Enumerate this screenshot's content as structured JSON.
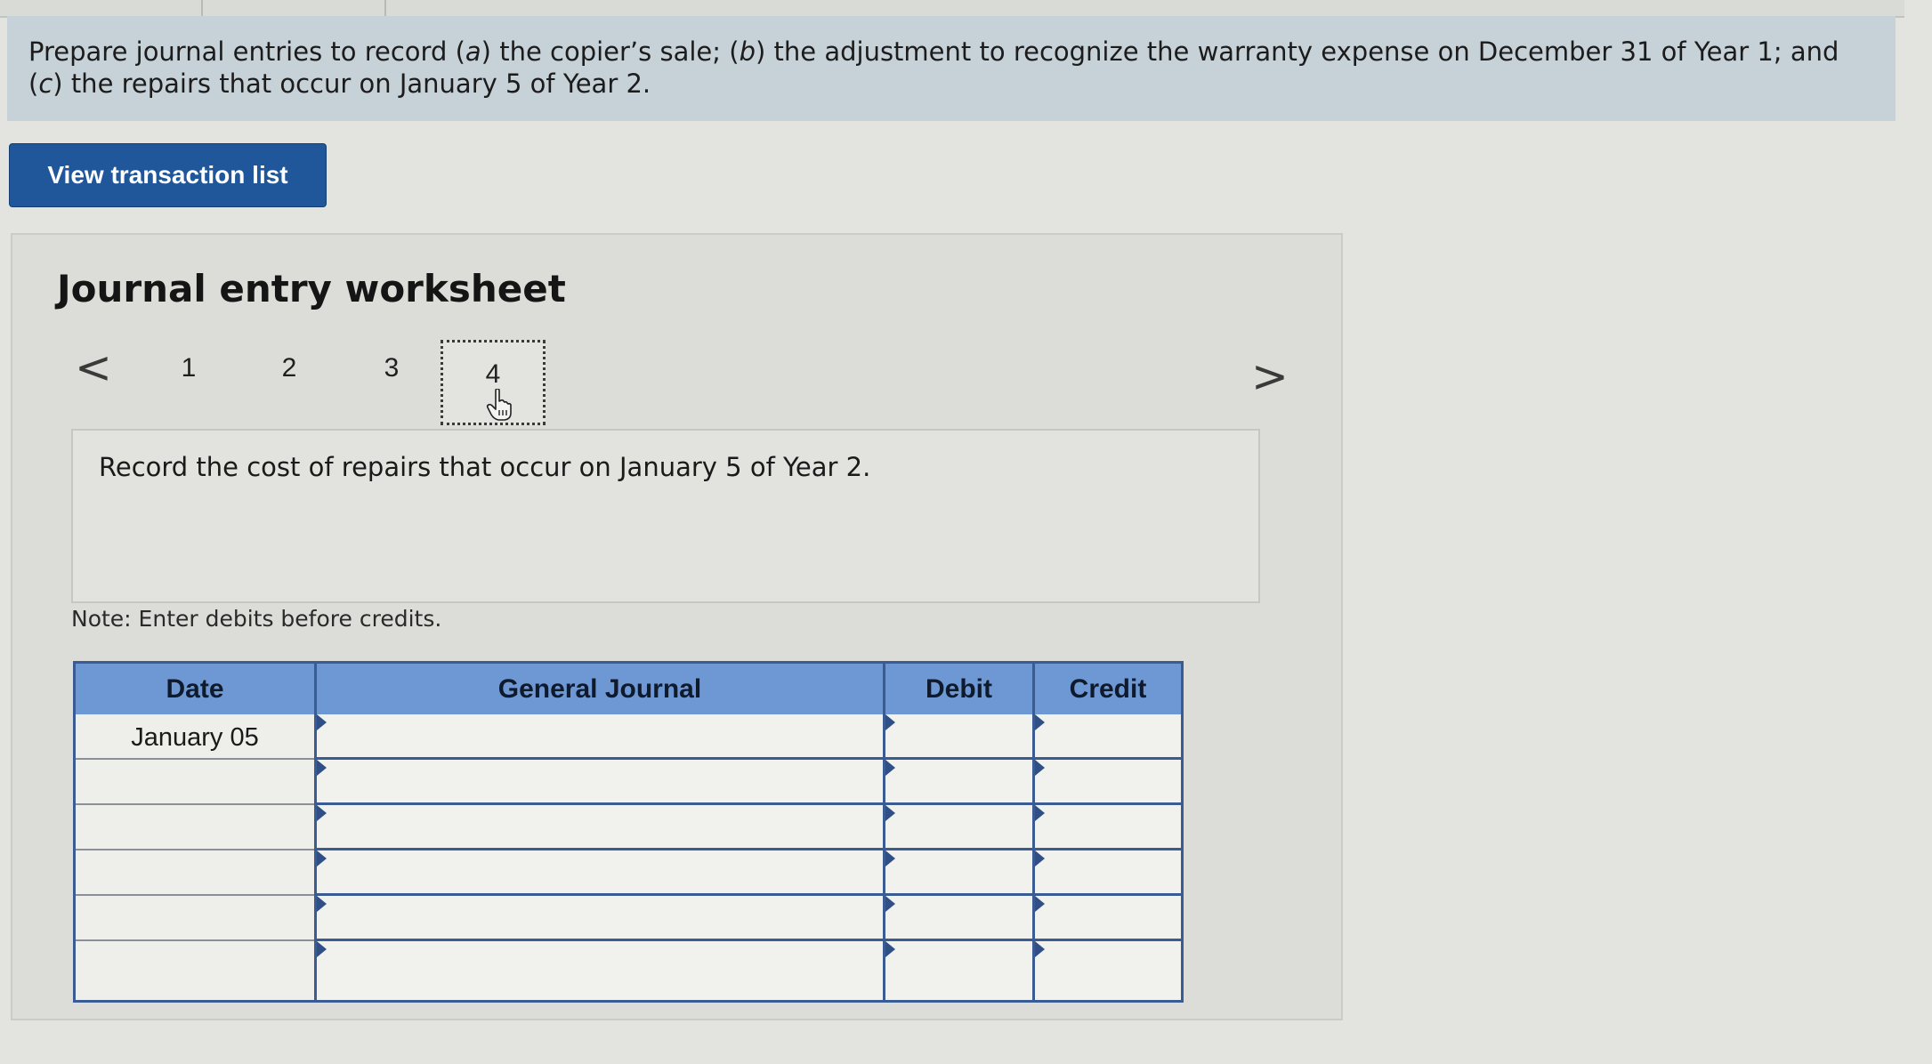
{
  "instructions": {
    "prefix": "Prepare journal entries to record (",
    "a": "a",
    "mid1": ") the copier’s sale; (",
    "b": "b",
    "mid2": ") the adjustment to recognize the warranty expense on December 31 of Year 1; and (",
    "c": "c",
    "suffix": ") the repairs that occur on January 5 of Year 2."
  },
  "view_transaction_button": "View transaction list",
  "worksheet": {
    "title": "Journal entry worksheet",
    "prev_arrow": "<",
    "next_arrow": ">",
    "pages": [
      "1",
      "2",
      "3",
      "4"
    ],
    "current_page": "4",
    "prompt": "Record the cost of repairs that occur on January 5 of Year 2.",
    "note": "Note: Enter debits before credits."
  },
  "journal": {
    "headers": {
      "date": "Date",
      "general_journal": "General Journal",
      "debit": "Debit",
      "credit": "Credit"
    },
    "rows": [
      {
        "date": "January 05",
        "account": "",
        "debit": "",
        "credit": ""
      },
      {
        "date": "",
        "account": "",
        "debit": "",
        "credit": ""
      },
      {
        "date": "",
        "account": "",
        "debit": "",
        "credit": ""
      },
      {
        "date": "",
        "account": "",
        "debit": "",
        "credit": ""
      },
      {
        "date": "",
        "account": "",
        "debit": "",
        "credit": ""
      },
      {
        "date": "",
        "account": "",
        "debit": "",
        "credit": ""
      }
    ]
  },
  "colors": {
    "instruction_bg": "#c6d1d8",
    "button_bg": "#20579a",
    "table_header_bg": "#6e98d3",
    "table_border": "#3b5c93"
  },
  "icons": {
    "cursor": "hand-pointer-icon",
    "prev": "chevron-left-icon",
    "next": "chevron-right-icon"
  }
}
